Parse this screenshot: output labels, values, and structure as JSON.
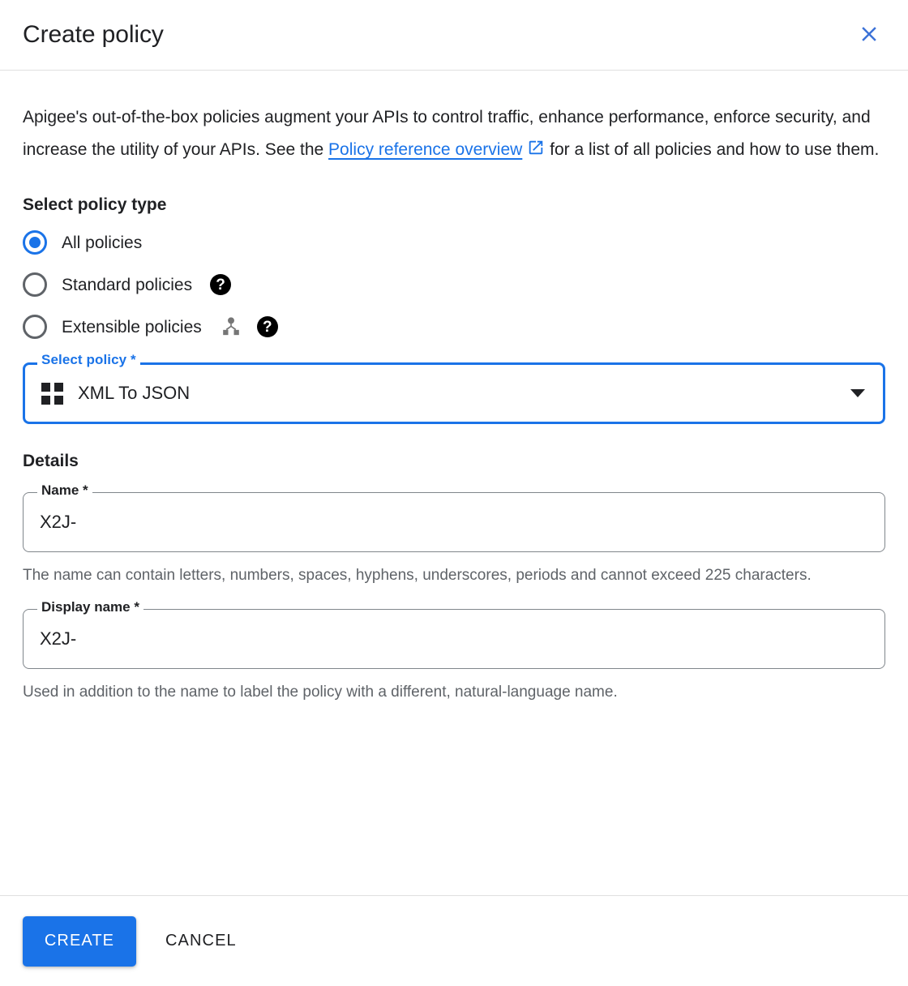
{
  "dialog": {
    "title": "Create policy",
    "close_icon": "close-icon"
  },
  "intro": {
    "text_before_link": "Apigee's out-of-the-box policies augment your APIs to control traffic, enhance performance, enforce security, and increase the utility of your APIs. See the ",
    "link_text": "Policy reference overview",
    "link_icon": "external-link-icon",
    "text_after_link": " for a list of all policies and how to use them."
  },
  "policy_type": {
    "heading": "Select policy type",
    "options": [
      {
        "label": "All policies",
        "checked": true,
        "icons": []
      },
      {
        "label": "Standard policies",
        "checked": false,
        "icons": [
          "help-icon"
        ]
      },
      {
        "label": "Extensible policies",
        "checked": false,
        "icons": [
          "extension-hub-icon",
          "help-icon"
        ]
      }
    ]
  },
  "select_policy": {
    "legend": "Select policy *",
    "value": "XML To JSON",
    "leading_icon": "policy-grid-icon",
    "dropdown_icon": "chevron-down-icon",
    "accent_color": "#1a73e8"
  },
  "details": {
    "heading": "Details",
    "name_field": {
      "legend": "Name *",
      "value": "X2J-",
      "placeholder": "",
      "helper": "The name can contain letters, numbers, spaces, hyphens, underscores, periods and cannot exceed 225 characters."
    },
    "display_name_field": {
      "legend": "Display name *",
      "value": "X2J-",
      "placeholder": "",
      "helper": "Used in addition to the name to label the policy with a different, natural-language name."
    }
  },
  "footer": {
    "create_label": "CREATE",
    "cancel_label": "CANCEL"
  },
  "colors": {
    "accent": "#1a73e8",
    "text": "#202124",
    "muted": "#5f6368",
    "divider": "#e0e0e0"
  }
}
